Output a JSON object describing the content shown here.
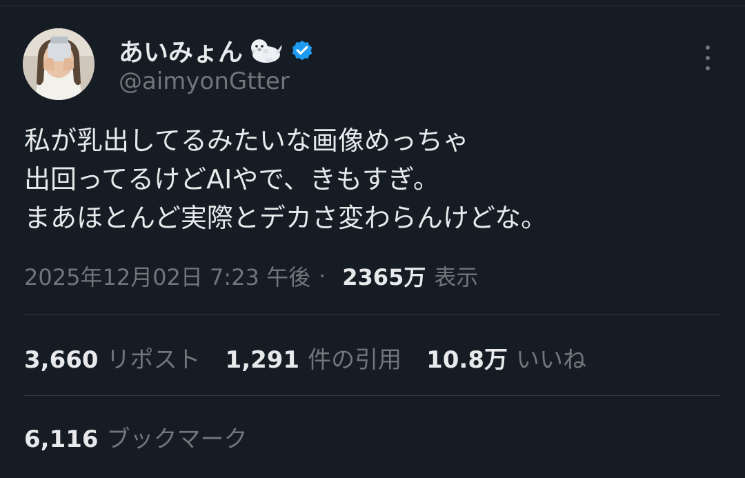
{
  "author": {
    "display_name": "あいみょん",
    "handle": "@aimyonGtter",
    "name_emoji": "seal-icon",
    "verified_color": "#1d9bf0"
  },
  "tweet": {
    "text_lines": [
      "私が乳出してるみたいな画像めっちゃ",
      "出回ってるけどAIやで、きもすぎ。",
      "まあほとんど実際とデカさ変わらんけどな。"
    ],
    "timestamp": "2025年12月02日 7:23 午後",
    "separator": "·",
    "views_count": "2365万",
    "views_label": "表示"
  },
  "stats": {
    "reposts": {
      "count": "3,660",
      "label": "リポスト"
    },
    "quotes": {
      "count": "1,291",
      "label": "件の引用"
    },
    "likes": {
      "count": "10.8万",
      "label": "いいね"
    },
    "bookmarks": {
      "count": "6,116",
      "label": "ブックマーク"
    }
  },
  "colors": {
    "background": "#151c24",
    "text_primary": "#e7e9ea",
    "text_secondary": "#71767b",
    "divider": "#2f3740"
  }
}
